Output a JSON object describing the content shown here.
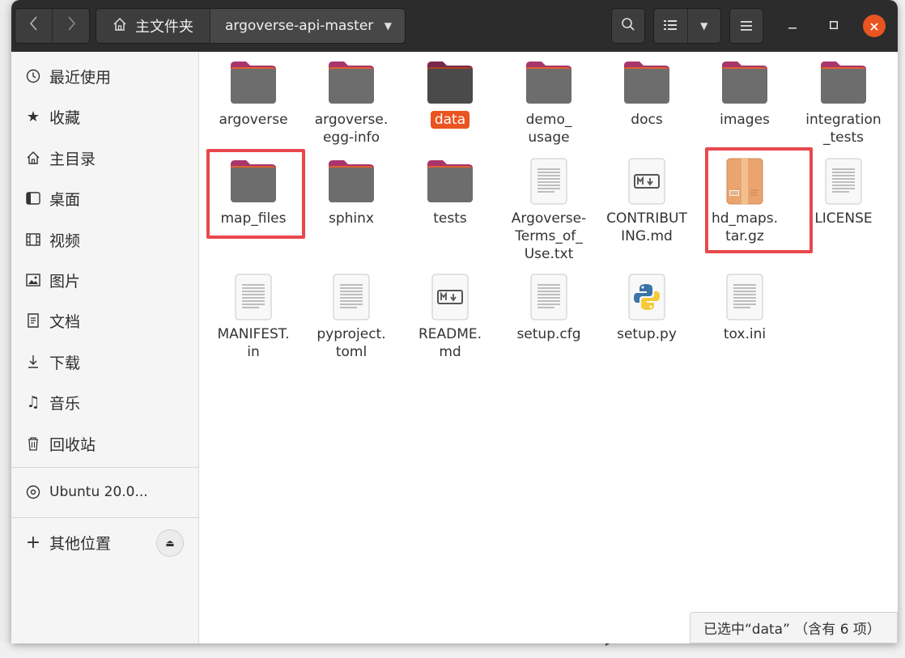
{
  "header": {
    "back_icon": "chevron-left-icon",
    "forward_icon": "chevron-right-icon",
    "home_label": "主文件夹",
    "current_folder": "argoverse-api-master",
    "search_icon": "search-icon",
    "list_view_icon": "list-view-icon",
    "view_options_icon": "chevron-down-icon",
    "menu_icon": "hamburger-menu-icon",
    "accent_color": "#e95420"
  },
  "sidebar": {
    "items": [
      {
        "label": "最近使用",
        "icon": "clock-icon"
      },
      {
        "label": "收藏",
        "icon": "star-icon"
      },
      {
        "label": "主目录",
        "icon": "home-icon"
      },
      {
        "label": "桌面",
        "icon": "desktop-icon"
      },
      {
        "label": "视频",
        "icon": "film-icon"
      },
      {
        "label": "图片",
        "icon": "picture-icon"
      },
      {
        "label": "文档",
        "icon": "document-icon"
      },
      {
        "label": "下载",
        "icon": "download-icon"
      },
      {
        "label": "音乐",
        "icon": "music-icon"
      },
      {
        "label": "回收站",
        "icon": "trash-icon"
      }
    ],
    "device": {
      "label": "Ubuntu 20.0...",
      "icon": "disc-icon"
    },
    "other": {
      "label": "其他位置",
      "icon": "plus-icon"
    }
  },
  "files": [
    {
      "name": "argoverse",
      "type": "folder"
    },
    {
      "name": "argoverse.\negg-info",
      "type": "folder"
    },
    {
      "name": "data",
      "type": "folder",
      "selected": true
    },
    {
      "name": "demo_\nusage",
      "type": "folder"
    },
    {
      "name": "docs",
      "type": "folder"
    },
    {
      "name": "images",
      "type": "folder"
    },
    {
      "name": "integration\n_tests",
      "type": "folder"
    },
    {
      "name": "map_files",
      "type": "folder",
      "highlighted": true
    },
    {
      "name": "sphinx",
      "type": "folder"
    },
    {
      "name": "tests",
      "type": "folder"
    },
    {
      "name": "Argoverse-\nTerms_of_\nUse.txt",
      "type": "text"
    },
    {
      "name": "CONTRIBUT\nING.md",
      "type": "markdown"
    },
    {
      "name": "hd_maps.\ntar.gz",
      "type": "archive",
      "highlighted": true
    },
    {
      "name": "LICENSE",
      "type": "text"
    },
    {
      "name": "MANIFEST.\nin",
      "type": "text"
    },
    {
      "name": "pyproject.\ntoml",
      "type": "text"
    },
    {
      "name": "README.\nmd",
      "type": "markdown"
    },
    {
      "name": "setup.cfg",
      "type": "text"
    },
    {
      "name": "setup.py",
      "type": "python"
    },
    {
      "name": "tox.ini",
      "type": "text"
    }
  ],
  "status": "已选中“data” （含有 6 项）"
}
